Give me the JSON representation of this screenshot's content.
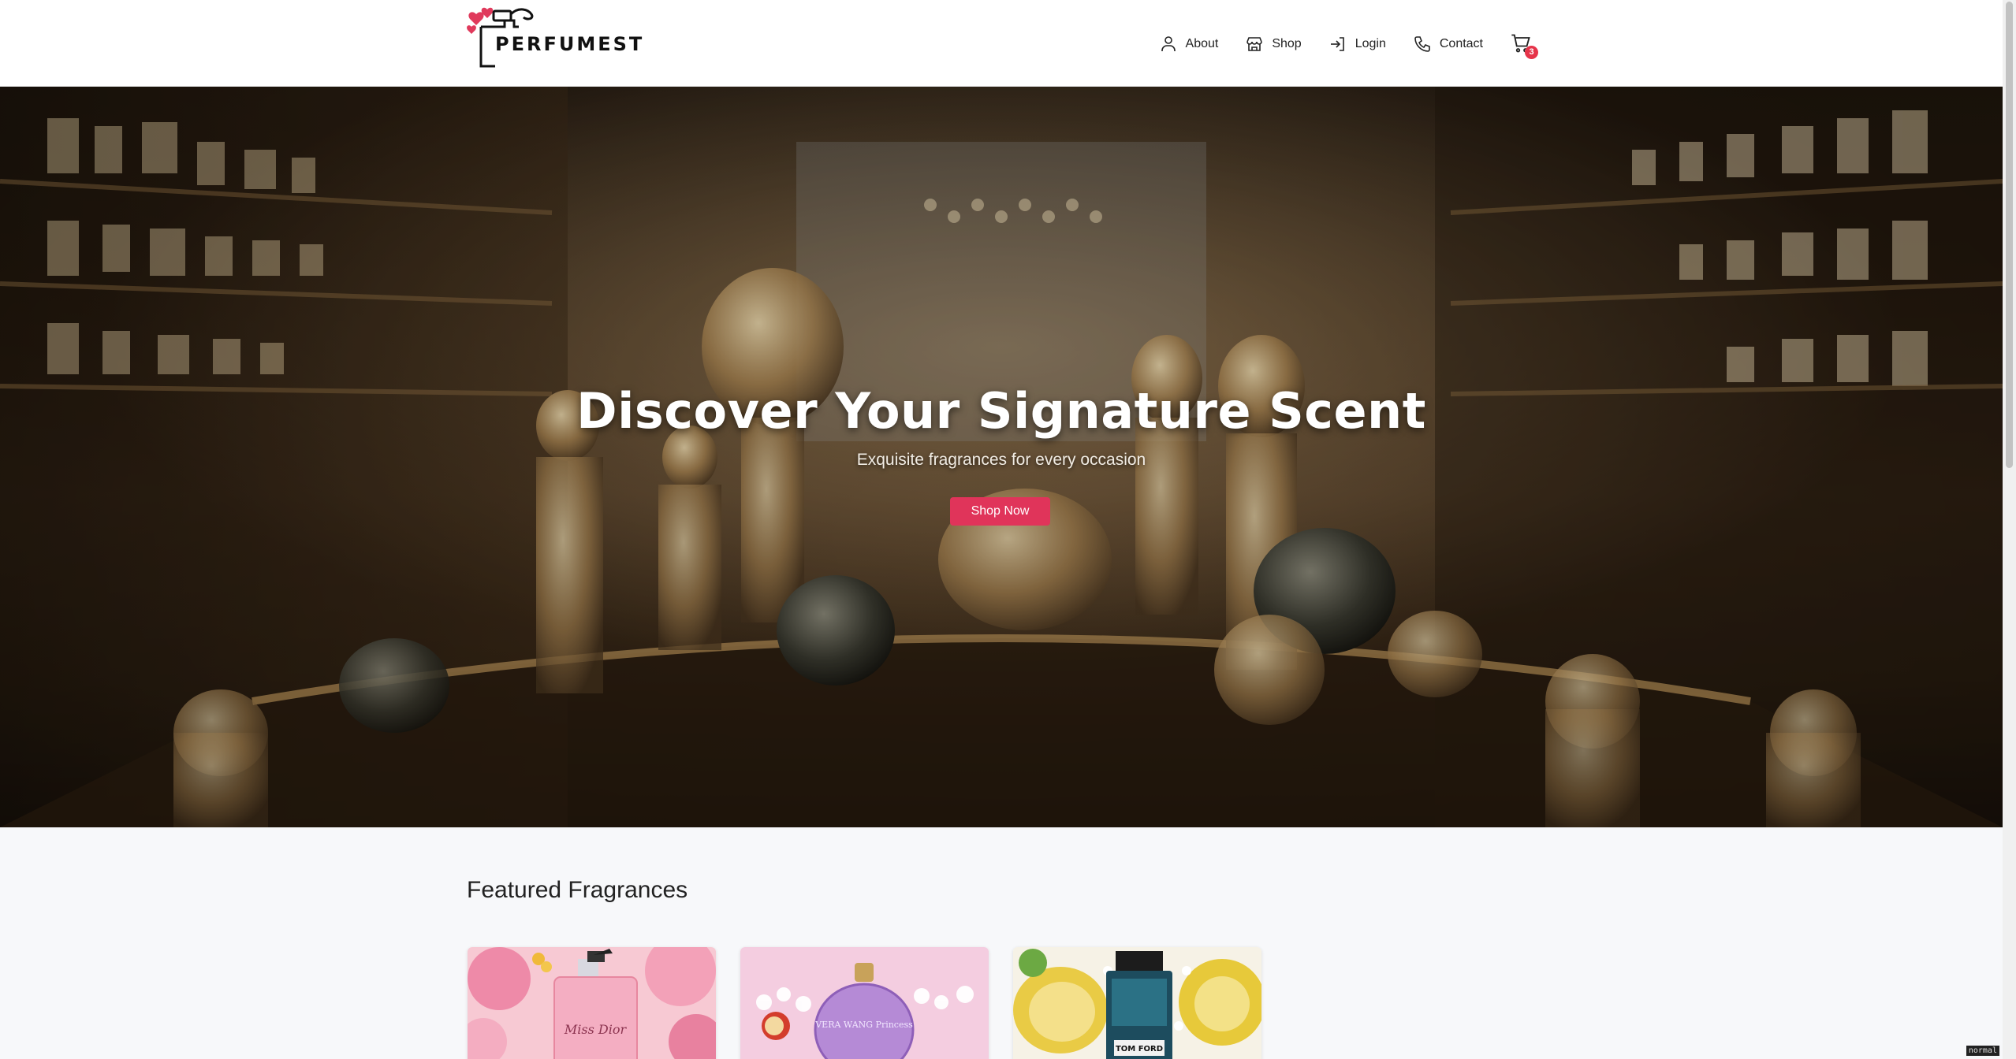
{
  "brand": {
    "name": "PERFUMEST"
  },
  "nav": {
    "items": [
      {
        "label": "About",
        "icon": "user-icon"
      },
      {
        "label": "Shop",
        "icon": "store-icon"
      },
      {
        "label": "Login",
        "icon": "login-icon"
      },
      {
        "label": "Contact",
        "icon": "phone-icon"
      }
    ],
    "cart": {
      "icon": "cart-icon",
      "count": "3"
    }
  },
  "hero": {
    "title": "Discover Your Signature Scent",
    "subtitle": "Exquisite fragrances for every occasion",
    "cta_label": "Shop Now"
  },
  "featured": {
    "heading": "Featured Fragrances",
    "cards": [
      {
        "bottle_label": "Miss Dior"
      },
      {
        "bottle_label": "VERA WANG Princess"
      },
      {
        "bottle_label": "TOM FORD"
      }
    ]
  },
  "status": {
    "mode": "normal"
  },
  "colors": {
    "accent": "#e0345a",
    "badge": "#e6344a",
    "nav_bg": "#ffffff",
    "page_bg": "#f7f8fa"
  }
}
